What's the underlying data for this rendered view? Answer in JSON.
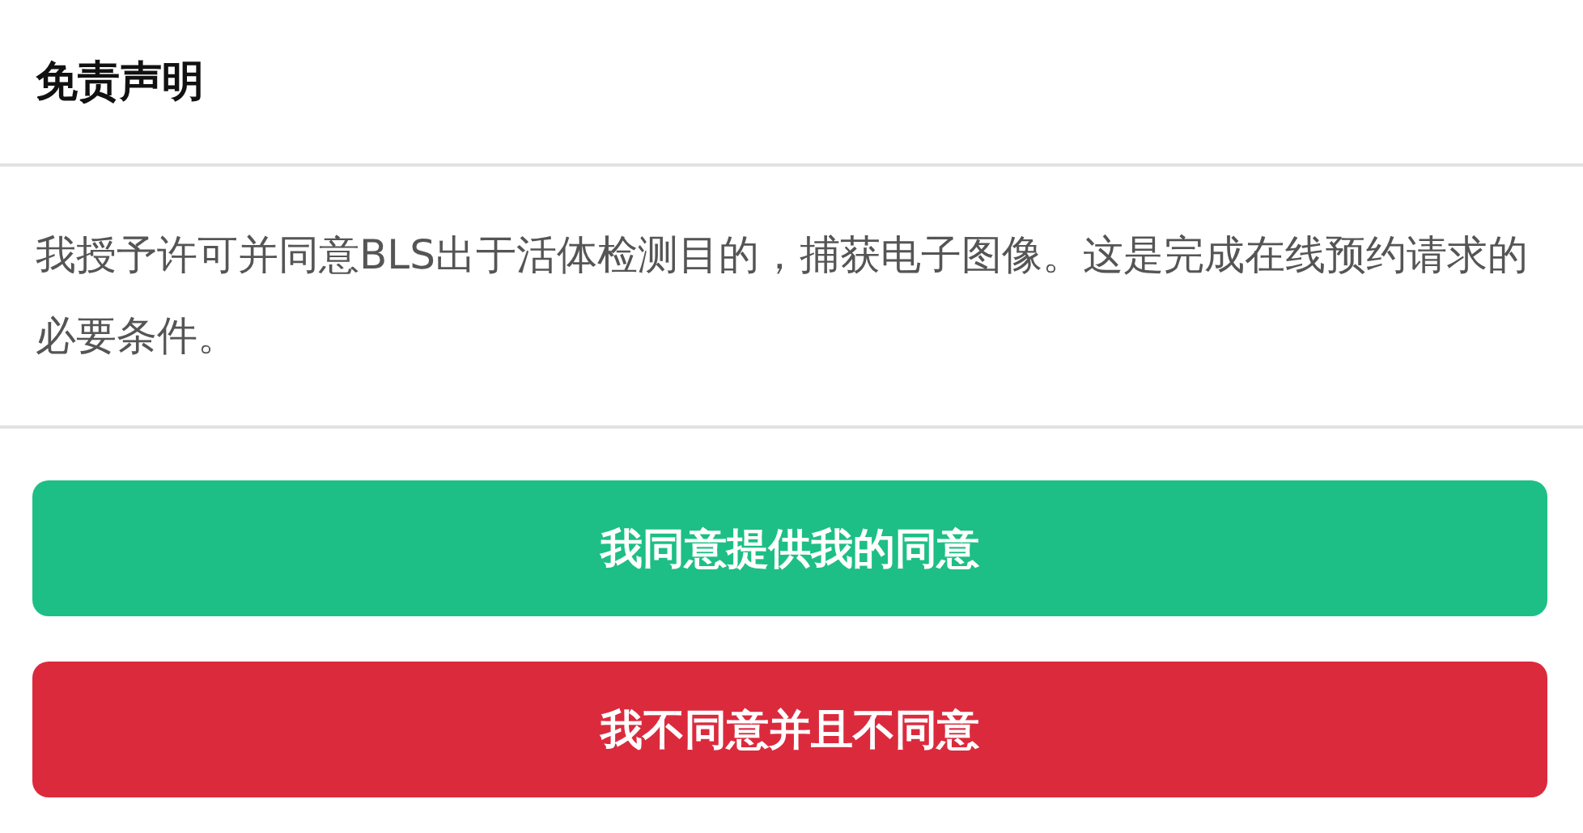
{
  "title": "免责声明",
  "message": "我授予许可并同意BLS出于活体检测目的，捕获电子图像。这是完成在线预约请求的必要条件。",
  "buttons": [
    {
      "label": "我同意提供我的同意",
      "kind": "agree"
    },
    {
      "label": "我不同意并且不同意",
      "kind": "decline"
    }
  ]
}
